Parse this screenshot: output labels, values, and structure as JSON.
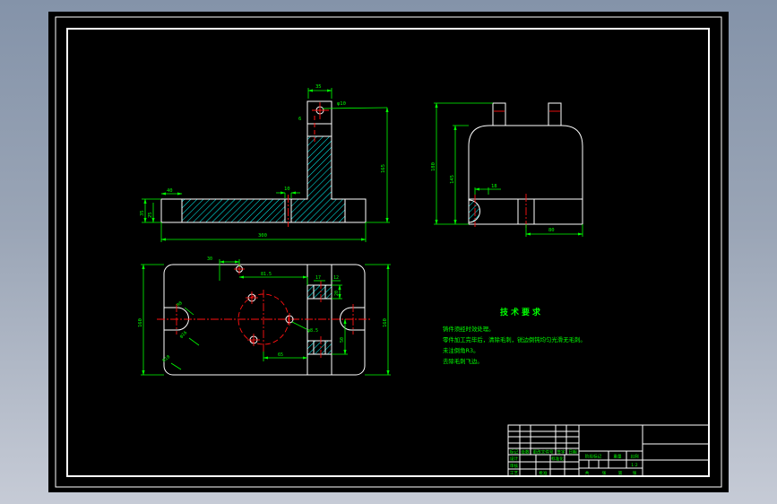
{
  "app": {
    "background_top": "#8493a9",
    "background_bottom": "#c6cbd6",
    "canvas_color": "#000000"
  },
  "colors": {
    "outline": "#ffffff",
    "dimension": "#00ff00",
    "centerline": "#ff1111",
    "hatch": "#00ffff"
  },
  "views": {
    "front_section": {
      "dims": {
        "tab_width": "35",
        "hole_label": "φ10",
        "tab_side": "6",
        "overall_height": "165",
        "base_height_outer": "35",
        "base_height_inner": "25",
        "lug_width": "40",
        "slot_width": "10",
        "overall_width": "300"
      }
    },
    "side_view": {
      "dims": {
        "overall_height": "180",
        "body_height": "145",
        "boss_width": "18",
        "bottom_width": "80"
      }
    },
    "plan_view": {
      "dims": {
        "hole_offset": "30",
        "hole_pitch": "81.5",
        "slot_a": "17",
        "slot_b": "12",
        "col_depth": "20",
        "col_span": "50",
        "height_left": "160",
        "height_right": "160",
        "center_to_col": "65",
        "hole_label": "φ8.5",
        "fillet_a": "R8",
        "slot_dia": "φ16",
        "fillet_b": "R10"
      }
    }
  },
  "tech_requirements": {
    "title": "技术要求",
    "lines": [
      "铸件须经时效处理。",
      "零件加工完毕后，清除毛刺，锐边倒钝均匀光滑无毛刺。",
      "未注倒角R3。",
      "去除毛刺飞边。"
    ]
  },
  "title_block": {
    "revision_headers": [
      "标记",
      "处数",
      "更改文件号",
      "签字",
      "日期"
    ],
    "roles": {
      "design": "设计",
      "standardize": "标准化",
      "check": "审核",
      "process": "工艺",
      "approve": "批准"
    },
    "stage_label": "阶段标记",
    "weight_label": "重量",
    "scale_label": "比例",
    "scale_value": "1:2",
    "sheet": {
      "total_label": "共",
      "total_unit": "张",
      "page_label": "第",
      "page_unit": "张"
    }
  }
}
